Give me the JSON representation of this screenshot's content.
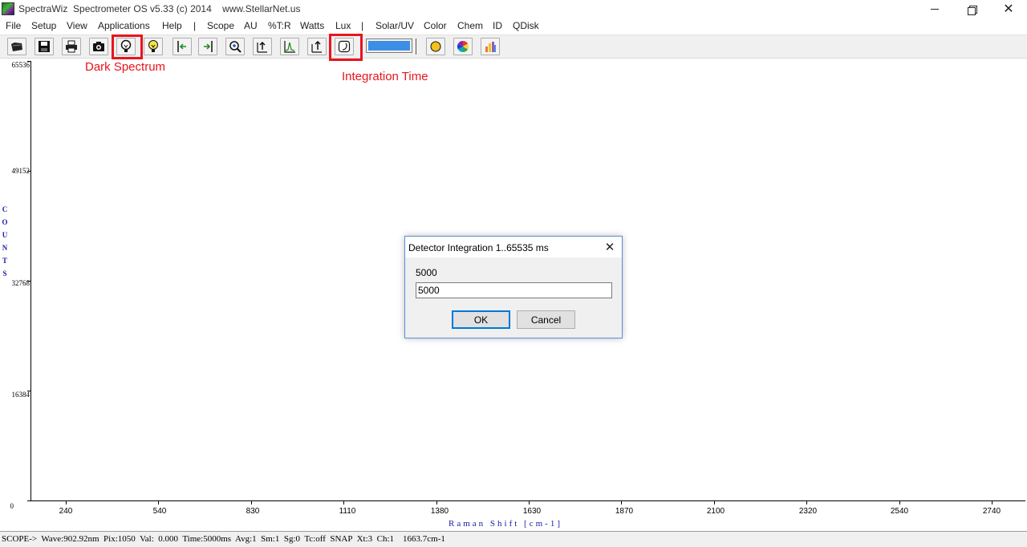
{
  "window": {
    "title": "SpectraWiz  Spectrometer OS v5.33 (c) 2014    www.StellarNet.us",
    "minimize_icon": "minimize-icon",
    "maximize_icon": "restore-icon",
    "close_icon": "close-icon"
  },
  "menu": [
    {
      "label": "File"
    },
    {
      "label": "Setup"
    },
    {
      "label": "View"
    },
    {
      "label": "Applications"
    },
    {
      "label": "Help"
    },
    {
      "label": "|"
    },
    {
      "label": "Scope"
    },
    {
      "label": "AU"
    },
    {
      "label": "%T:R"
    },
    {
      "label": "Watts"
    },
    {
      "label": "Lux"
    },
    {
      "label": "|"
    },
    {
      "label": "Solar/UV"
    },
    {
      "label": "Color"
    },
    {
      "label": "Chem"
    },
    {
      "label": "ID"
    },
    {
      "label": "QDisk"
    }
  ],
  "toolbar": {
    "buttons": [
      {
        "icon": "open-file-icon"
      },
      {
        "icon": "save-icon"
      },
      {
        "icon": "print-icon"
      },
      {
        "icon": "camera-icon"
      },
      {
        "icon": "dark-bulb-icon"
      },
      {
        "icon": "light-bulb-icon"
      },
      {
        "icon": "arrow-left-icon"
      },
      {
        "icon": "arrow-right-icon"
      },
      {
        "icon": "zoom-icon"
      },
      {
        "icon": "autoscale-icon"
      },
      {
        "icon": "peak-icon"
      },
      {
        "icon": "scale-up-icon"
      },
      {
        "icon": "integration-time-icon"
      },
      {
        "icon": "sun-icon"
      },
      {
        "icon": "color-wheel-icon"
      },
      {
        "icon": "chart-icon"
      }
    ],
    "progress_color": "#3d8fe6"
  },
  "annotations": {
    "dark_spectrum_label": "Dark Spectrum",
    "integration_time_label": "Integration Time",
    "highlight_color": "#e8141c"
  },
  "chart_data": {
    "type": "line",
    "title": "",
    "xlabel": "Raman Shift [cm-1]",
    "ylabel": "COUNTS",
    "x_ticks": [
      "240",
      "540",
      "830",
      "1110",
      "1380",
      "1630",
      "1870",
      "2100",
      "2320",
      "2540",
      "2740"
    ],
    "y_ticks": [
      "65536",
      "49152",
      "32768",
      "16384",
      "0"
    ],
    "ylim": [
      0,
      65536
    ],
    "series": [],
    "grid": false
  },
  "status": {
    "text": "SCOPE->  Wave:902.92nm  Pix:1050  Val:  0.000  Time:5000ms  Avg:1  Sm:1  Sg:0  Tc:off  SNAP  Xt:3  Ch:1    1663.7cm-1"
  },
  "dialog": {
    "title": "Detector Integration 1..65535 ms",
    "prompt": "5000",
    "input_value": "5000",
    "ok_label": "OK",
    "cancel_label": "Cancel"
  }
}
